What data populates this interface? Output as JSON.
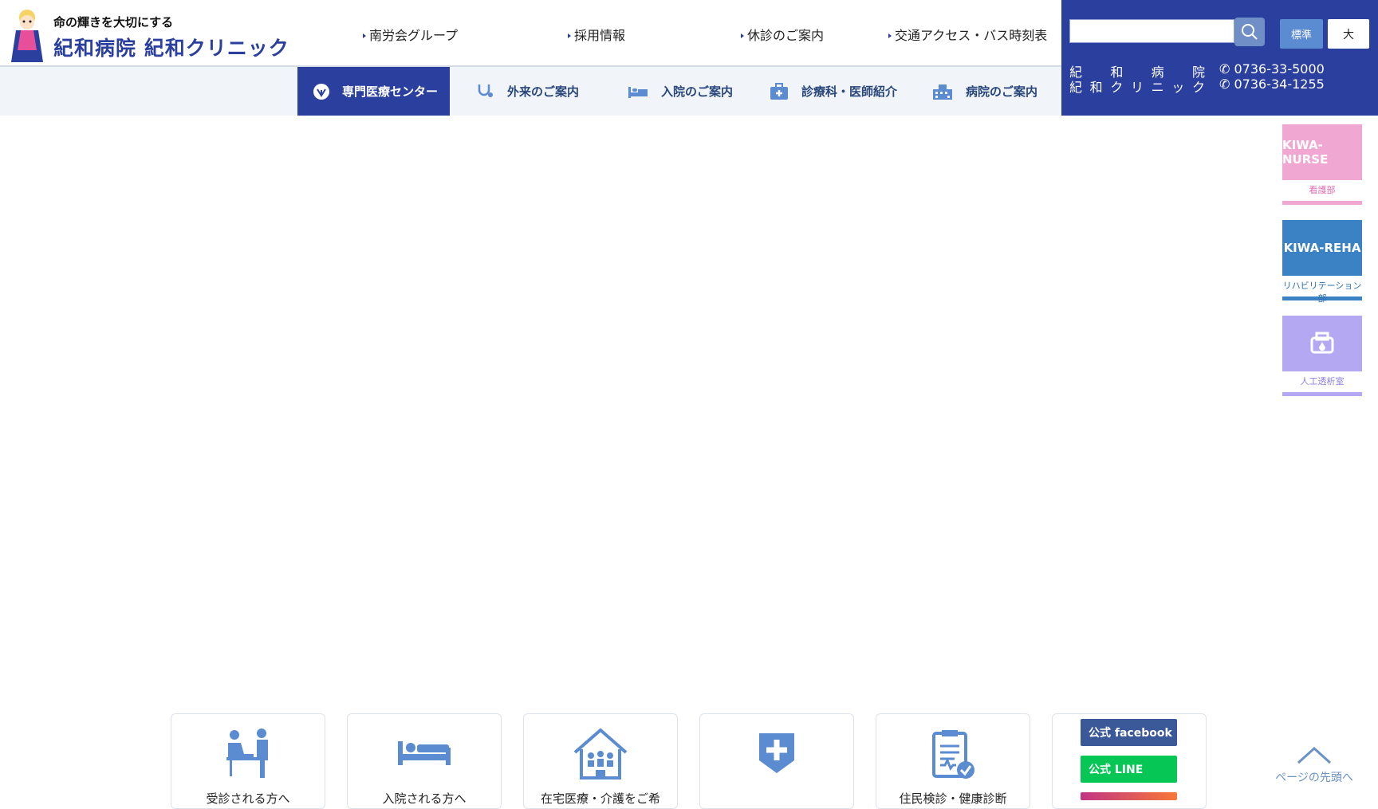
{
  "header": {
    "tagline": "命の輝きを大切にする",
    "site_name": "紀和病院 紀和クリニック",
    "top_nav": [
      "南労会グループ",
      "採用情報",
      "休診のご案内",
      "交通アクセス・バス時刻表"
    ],
    "sub_nav": [
      {
        "label": "専門医療センター",
        "icon": "leaf-icon",
        "active": true
      },
      {
        "label": "外来のご案内",
        "icon": "stethoscope-icon",
        "active": false
      },
      {
        "label": "入院のご案内",
        "icon": "bed-icon",
        "active": false
      },
      {
        "label": "診療科・医師紹介",
        "icon": "medical-bag-icon",
        "active": false
      },
      {
        "label": "病院のご案内",
        "icon": "hospital-icon",
        "active": false
      }
    ]
  },
  "utility": {
    "search_placeholder": "",
    "font_standard": "標準",
    "font_large": "大",
    "phones": [
      {
        "name_chars": [
          "紀",
          "和",
          "病",
          "院"
        ],
        "number": "0736-33-5000"
      },
      {
        "name_chars": [
          "紀",
          "和",
          "ク",
          "リ",
          "ニ",
          "ッ",
          "ク"
        ],
        "number": "0736-34-1255"
      }
    ]
  },
  "side_banners": [
    {
      "title": "KIWA-NURSE",
      "caption": "看護部",
      "color": "#f0a8d2",
      "text_color": "#e06aae"
    },
    {
      "title": "KIWA-REHA",
      "caption": "リハビリテーション部",
      "color": "#3b82c4",
      "text_color": "#2e6fb0"
    },
    {
      "title": "",
      "caption": "人工透析室",
      "color": "#b4a8f2",
      "text_color": "#8c7fe0",
      "icon": "dialysis-icon"
    }
  ],
  "cards": [
    {
      "label": "受診される方へ",
      "icon": "consultation-icon"
    },
    {
      "label": "入院される方へ",
      "icon": "bed-icon"
    },
    {
      "label": "在宅医療・介護をご希",
      "icon": "home-care-icon"
    },
    {
      "label": "",
      "icon": "emergency-shield-icon"
    },
    {
      "label": "住民検診・健康診断",
      "icon": "checklist-icon"
    }
  ],
  "sns": [
    {
      "label": "公式 facebook",
      "color": "#3b5998"
    },
    {
      "label": "公式 LINE",
      "color": "#06c755"
    }
  ],
  "back_to_top": "ページの先頭へ"
}
